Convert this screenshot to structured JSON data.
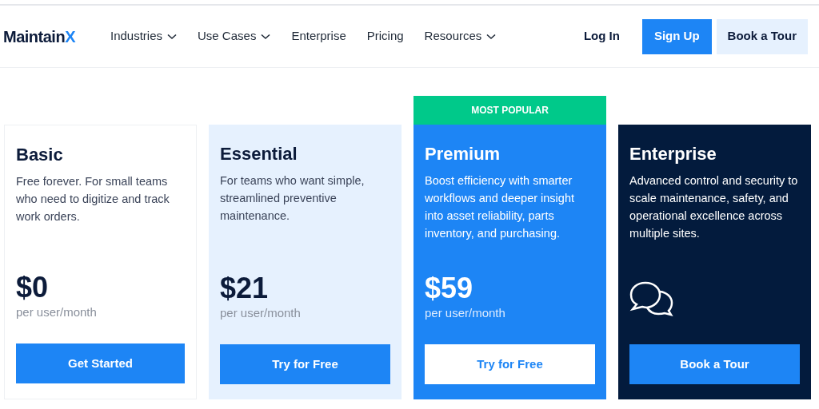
{
  "header": {
    "logo": {
      "text": "Maintain",
      "accent": "X"
    },
    "nav": [
      {
        "label": "Industries",
        "has_menu": true
      },
      {
        "label": "Use Cases",
        "has_menu": true
      },
      {
        "label": "Enterprise",
        "has_menu": false
      },
      {
        "label": "Pricing",
        "has_menu": false
      },
      {
        "label": "Resources",
        "has_menu": true
      }
    ],
    "actions": [
      {
        "label": "Log In",
        "kind": "text"
      },
      {
        "label": "Sign Up",
        "kind": "primary"
      },
      {
        "label": "Book a Tour",
        "kind": "secondary"
      }
    ]
  },
  "plans": [
    {
      "kind": "light",
      "name": "Basic",
      "description": "Free forever. For small teams who need to digitize and track work orders.",
      "price": "$0",
      "unit": "per user/month",
      "button": "Get Started"
    },
    {
      "kind": "tint",
      "name": "Essential",
      "description": "For teams who want simple, streamlined preventive maintenance.",
      "price": "$21",
      "unit": "per user/month",
      "button": "Try for Free"
    },
    {
      "kind": "blue",
      "badge": "MOST POPULAR",
      "name": "Premium",
      "description": "Boost efficiency with smarter workflows and deeper insight into asset reliability, parts inventory, and purchasing.",
      "price": "$59",
      "unit": "per user/month",
      "button": "Try for Free"
    },
    {
      "kind": "dark",
      "name": "Enterprise",
      "description": "Advanced control and security to scale maintenance, safety, and operational excellence across multiple sites.",
      "button": "Book a Tour"
    }
  ]
}
